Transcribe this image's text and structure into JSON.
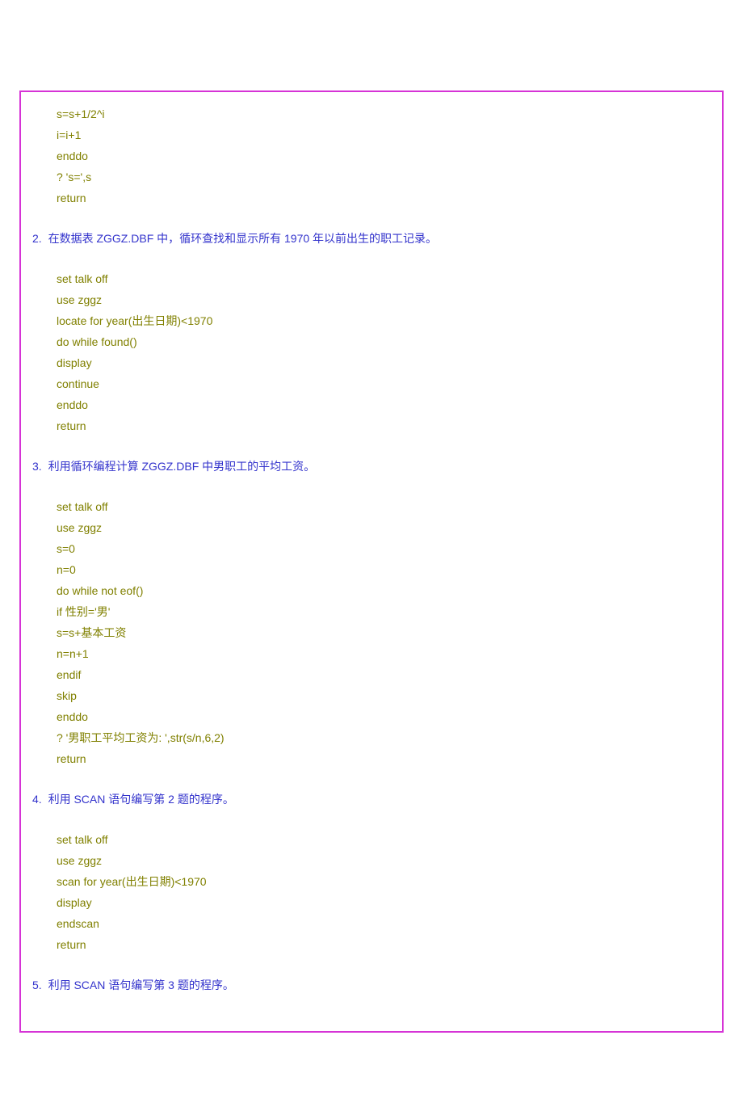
{
  "block1": {
    "lines": [
      "s=s+1/2^i",
      "i=i+1",
      "enddo",
      "? 's=',s",
      "return"
    ]
  },
  "h2": {
    "num": "2.",
    "text": "在数据表 ZGGZ.DBF 中，循环查找和显示所有 1970 年以前出生的职工记录。"
  },
  "block2": {
    "lines": [
      "set talk off",
      "use zggz",
      "locate for year(出生日期)<1970",
      "do while found()",
      "display",
      "continue",
      "enddo",
      "return"
    ]
  },
  "h3": {
    "num": "3.",
    "text": "利用循环编程计算 ZGGZ.DBF 中男职工的平均工资。"
  },
  "block3": {
    "lines": [
      "set talk off",
      "use zggz",
      "s=0",
      "n=0",
      "do while not eof()",
      "if 性别='男'",
      "s=s+基本工资",
      "n=n+1",
      "endif",
      "skip",
      "enddo",
      "? '男职工平均工资为: ',str(s/n,6,2)",
      "return"
    ]
  },
  "h4": {
    "num": "4.",
    "text": "利用 SCAN 语句编写第 2 题的程序。"
  },
  "block4": {
    "lines": [
      "set talk off",
      "use zggz",
      "scan for year(出生日期)<1970",
      "display",
      "endscan",
      "return"
    ]
  },
  "h5": {
    "num": "5.",
    "text": "利用 SCAN 语句编写第 3 题的程序。"
  }
}
